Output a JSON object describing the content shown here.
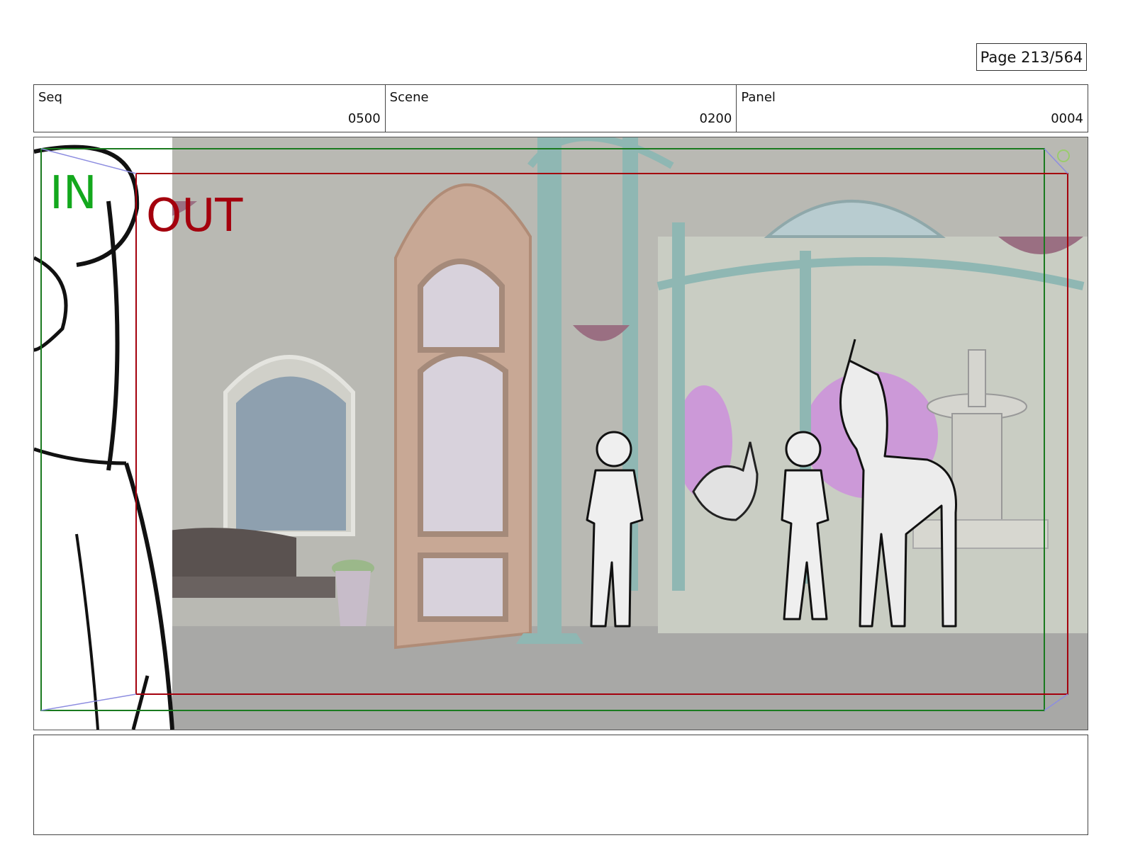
{
  "page": {
    "label": "Page 213/564"
  },
  "header": {
    "seq_label": "Seq",
    "seq_value": "0500",
    "scene_label": "Scene",
    "scene_value": "0200",
    "panel_label": "Panel",
    "panel_value": "0004"
  },
  "panel": {
    "in_label": "IN",
    "out_label": "OUT",
    "in_color": "#13a81d",
    "out_color": "#a4000d"
  },
  "caption": {
    "text": ""
  }
}
